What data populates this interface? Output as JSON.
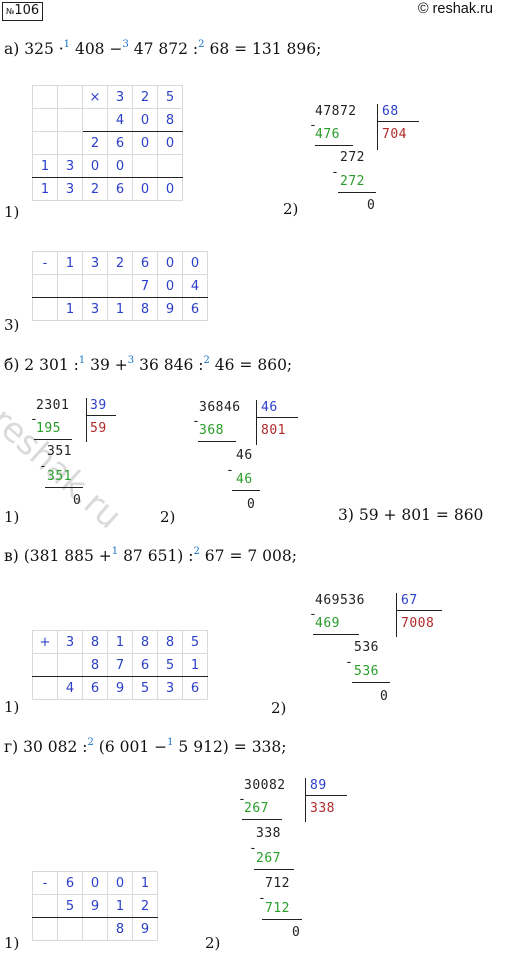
{
  "header": {
    "badge_sym": "№",
    "badge_num": "106",
    "site": "© reshak.ru"
  },
  "a": {
    "expr_pre": "а) 325 ·",
    "s1": "1",
    "expr_mid1": " 408 −",
    "s3": "3",
    "expr_mid2": " 47 872 :",
    "s2": "2",
    "expr_end": " 68 = 131 896;",
    "step1": "1)",
    "step2": "2)",
    "step3": "3)",
    "mult": {
      "op": "×",
      "r1": [
        "3",
        "2",
        "5"
      ],
      "r2": [
        "4",
        "0",
        "8"
      ],
      "p1": [
        "2",
        "6",
        "0",
        "0"
      ],
      "p2": [
        "1",
        "3",
        "0",
        "0"
      ],
      "res": [
        "1",
        "3",
        "2",
        "6",
        "0",
        "0"
      ]
    },
    "div": {
      "dividend": "47872",
      "divisor": "68",
      "quot": "704",
      "m1": "476",
      "r1": "272",
      "m2": "272",
      "rem": "0",
      "minus": "-"
    },
    "sub": {
      "op": "-",
      "r1": [
        "1",
        "3",
        "2",
        "6",
        "0",
        "0"
      ],
      "r2": [
        "7",
        "0",
        "4"
      ],
      "res": [
        "1",
        "3",
        "1",
        "8",
        "9",
        "6"
      ]
    }
  },
  "b": {
    "expr_pre": "б) 2 301 :",
    "s1": "1",
    "expr_mid1": " 39 +",
    "s3": "3",
    "expr_mid2": " 36 846 :",
    "s2": "2",
    "expr_end": " 46 = 860;",
    "step1": "1)",
    "step2": "2)",
    "step3": "3) 59 + 801 = 860",
    "div1": {
      "dividend": "2301",
      "divisor": "39",
      "quot": "59",
      "m1": "195",
      "r1": "351",
      "m2": "351",
      "rem": "0",
      "minus": "-"
    },
    "div2": {
      "dividend": "36846",
      "divisor": "46",
      "quot": "801",
      "m1": "368",
      "r1": "46",
      "m2": "46",
      "rem": "0",
      "minus": "-"
    }
  },
  "v": {
    "expr_pre": "в) (381 885 +",
    "s1": "1",
    "expr_mid": " 87 651) :",
    "s2": "2",
    "expr_end": " 67 = 7 008;",
    "step1": "1)",
    "step2": "2)",
    "add": {
      "op": "+",
      "r1": [
        "3",
        "8",
        "1",
        "8",
        "8",
        "5"
      ],
      "r2": [
        "8",
        "7",
        "6",
        "5",
        "1"
      ],
      "res": [
        "4",
        "6",
        "9",
        "5",
        "3",
        "6"
      ]
    },
    "div": {
      "dividend": "469536",
      "divisor": "67",
      "quot": "7008",
      "m1": "469",
      "r1": "536",
      "m2": "536",
      "rem": "0",
      "minus": "-"
    }
  },
  "g": {
    "expr_pre": "г) 30 082 :",
    "s2": "2",
    "expr_mid": " (6 001 −",
    "s1": "1",
    "expr_end": " 5 912) = 338;",
    "step1": "1)",
    "step2": "2)",
    "sub": {
      "op": "-",
      "r1": [
        "6",
        "0",
        "0",
        "1"
      ],
      "r2": [
        "5",
        "9",
        "1",
        "2"
      ],
      "res": [
        "8",
        "9"
      ]
    },
    "div": {
      "dividend": "30082",
      "divisor": "89",
      "quot": "338",
      "m1": "267",
      "r1": "338",
      "m2": "267",
      "r2": "712",
      "m3": "712",
      "rem": "0",
      "minus": "-"
    }
  },
  "watermark": "reshak.ru"
}
